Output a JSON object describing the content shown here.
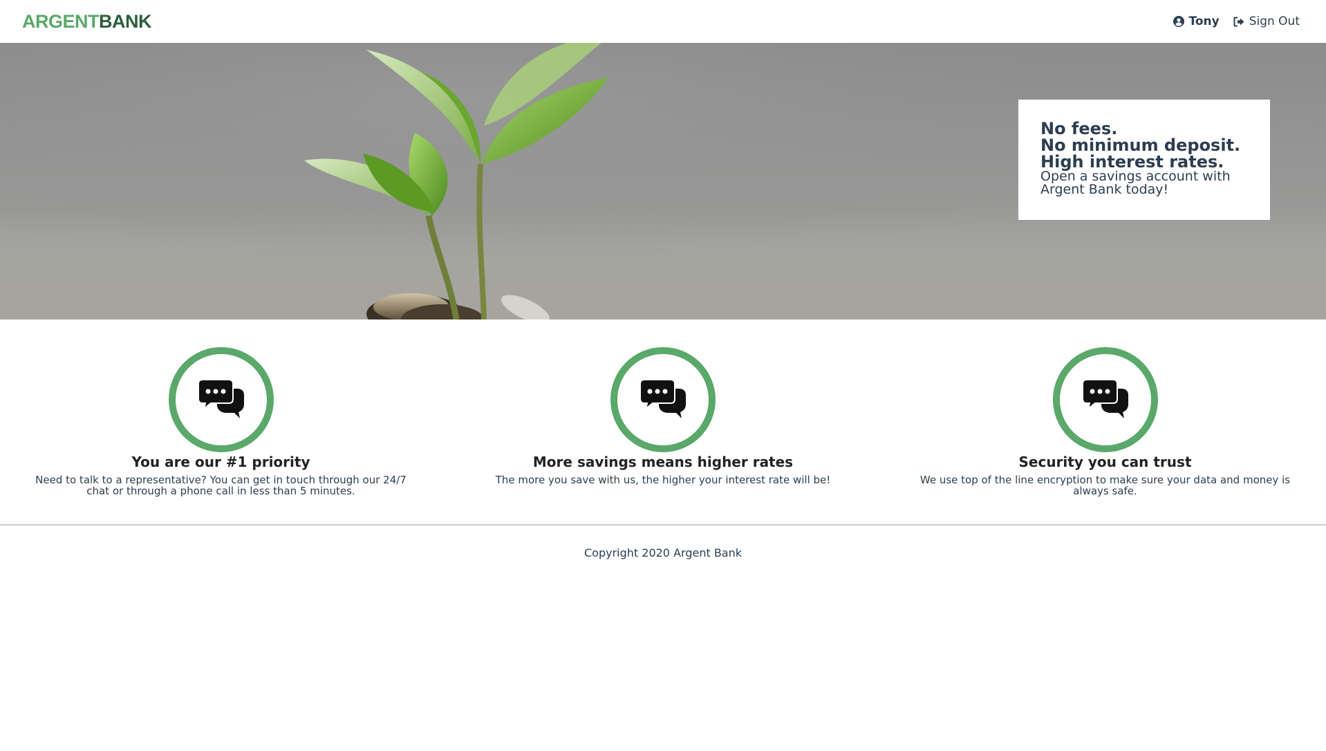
{
  "nav": {
    "logo_part1": "ARGENT",
    "logo_part2": "BANK",
    "user_name": "Tony",
    "signout_label": "Sign Out"
  },
  "hero": {
    "subtitles": [
      "No fees.",
      "No minimum deposit.",
      "High interest rates."
    ],
    "text": "Open a savings account with Argent Bank today!"
  },
  "features": [
    {
      "icon": "chat-icon",
      "title": "You are our #1 priority",
      "text": "Need to talk to a representative? You can get in touch through our 24/7 chat or through a phone call in less than 5 minutes."
    },
    {
      "icon": "chat-icon",
      "title": "More savings means higher rates",
      "text": "The more you save with us, the higher your interest rate will be!"
    },
    {
      "icon": "chat-icon",
      "title": "Security you can trust",
      "text": "We use top of the line encryption to make sure your data and money is always safe."
    }
  ],
  "footer": {
    "copyright": "Copyright 2020 Argent Bank"
  },
  "colors": {
    "brand_green": "#5aa86a",
    "brand_dark_green": "#2c5e3a",
    "text": "#2c3e50"
  }
}
